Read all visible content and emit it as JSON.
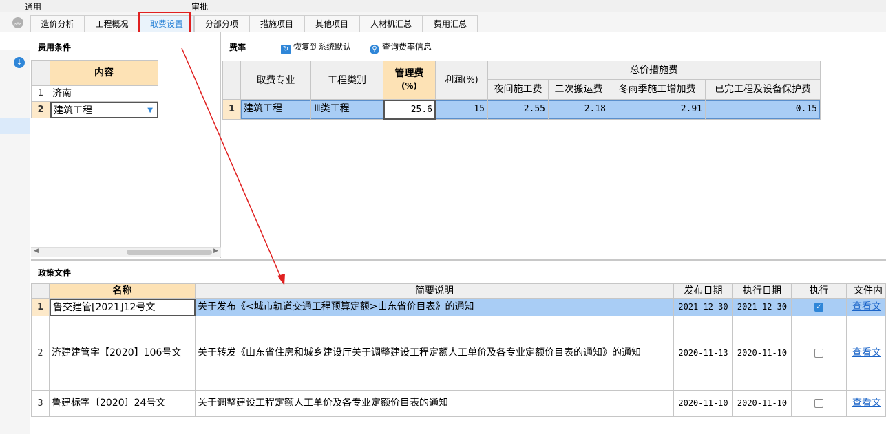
{
  "top_strip": {
    "left_label": "通用",
    "right_label": "审批"
  },
  "tabs": [
    {
      "label": "造价分析"
    },
    {
      "label": "工程概况"
    },
    {
      "label": "取费设置"
    },
    {
      "label": "分部分项"
    },
    {
      "label": "措施项目"
    },
    {
      "label": "其他项目"
    },
    {
      "label": "人材机汇总"
    },
    {
      "label": "费用汇总"
    }
  ],
  "conditions": {
    "title": "费用条件",
    "header": "内容",
    "rows": [
      {
        "num": "1",
        "value": "济南"
      },
      {
        "num": "2",
        "value": "建筑工程"
      }
    ]
  },
  "rates": {
    "title": "费率",
    "restore_label": "恢复到系统默认",
    "query_label": "查询费率信息",
    "headers": {
      "specialty": "取费专业",
      "category": "工程类别",
      "mgmt": "管理费",
      "mgmt_unit": "(%)",
      "profit": "利润(%)",
      "group": "总价措施费",
      "night": "夜间施工费",
      "secondary": "二次搬运费",
      "winter": "冬雨季施工增加费",
      "protect": "已完工程及设备保护费"
    },
    "rows": [
      {
        "num": "1",
        "specialty": "建筑工程",
        "category": "Ⅲ类工程",
        "mgmt": "25.6",
        "profit": "15",
        "night": "2.55",
        "secondary": "2.18",
        "winter": "2.91",
        "protect": "0.15"
      }
    ]
  },
  "policy": {
    "title": "政策文件",
    "headers": {
      "name": "名称",
      "desc": "简要说明",
      "publish": "发布日期",
      "exec_date": "执行日期",
      "execute": "执行",
      "file": "文件内"
    },
    "rows": [
      {
        "num": "1",
        "name": "鲁交建管[2021]12号文",
        "desc": "关于发布《<城市轨道交通工程预算定额>山东省价目表》的通知",
        "publish": "2021-12-30",
        "exec_date": "2021-12-30",
        "checked": true,
        "file": "查看文"
      },
      {
        "num": "2",
        "name": "济建建管字【2020】106号文",
        "desc": "关于转发《山东省住房和城乡建设厅关于调整建设工程定额人工单价及各专业定额价目表的通知》的通知",
        "publish": "2020-11-13",
        "exec_date": "2020-11-10",
        "checked": false,
        "file": "查看文"
      },
      {
        "num": "3",
        "name": "鲁建标字〔2020〕24号文",
        "desc": "关于调整建设工程定额人工单价及各专业定额价目表的通知",
        "publish": "2020-11-10",
        "exec_date": "2020-11-10",
        "checked": false,
        "file": "查看文"
      }
    ]
  },
  "colors": {
    "accent": "#2f86d8",
    "highlight_red": "#e02020",
    "selected_row": "#a9cdf5",
    "header_orange": "#fde2b5"
  }
}
